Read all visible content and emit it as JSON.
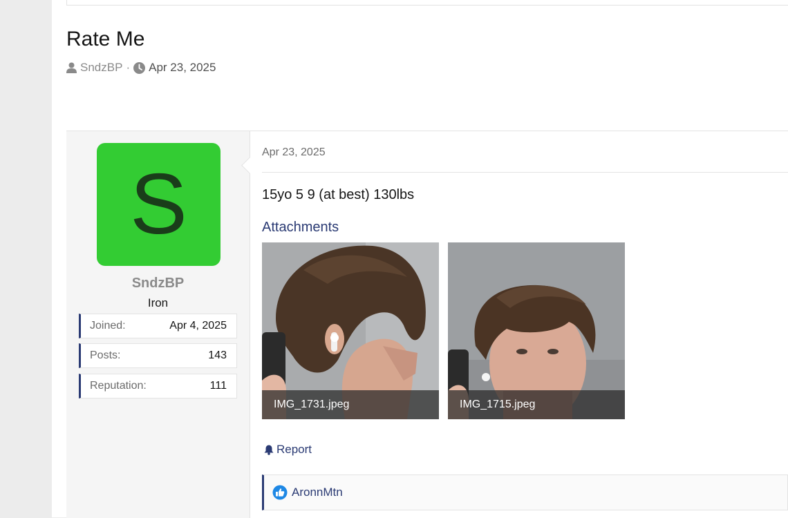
{
  "thread": {
    "title": "Rate Me",
    "author": "SndzBP",
    "separator": "·",
    "date": "Apr 23, 2025"
  },
  "user": {
    "avatar_letter": "S",
    "name": "SndzBP",
    "rank": "Iron",
    "stats": [
      {
        "label": "Joined:",
        "value": "Apr 4, 2025"
      },
      {
        "label": "Posts:",
        "value": "143"
      },
      {
        "label": "Reputation:",
        "value": "111"
      }
    ]
  },
  "post": {
    "date": "Apr 23, 2025",
    "body": "15yo 5 9 (at best) 130lbs",
    "attachments_title": "Attachments",
    "attachments": [
      {
        "filename": "IMG_1731.jpeg"
      },
      {
        "filename": "IMG_1715.jpeg"
      }
    ],
    "report_label": "Report",
    "reaction_user": "AronnMtn"
  },
  "colors": {
    "avatar_bg": "#33cc33",
    "link": "#2a3a73",
    "like_badge": "#1e88e5"
  },
  "icons": {
    "author": "user-icon",
    "date": "clock-icon",
    "report": "bell-icon",
    "reaction": "thumbs-up-icon"
  }
}
